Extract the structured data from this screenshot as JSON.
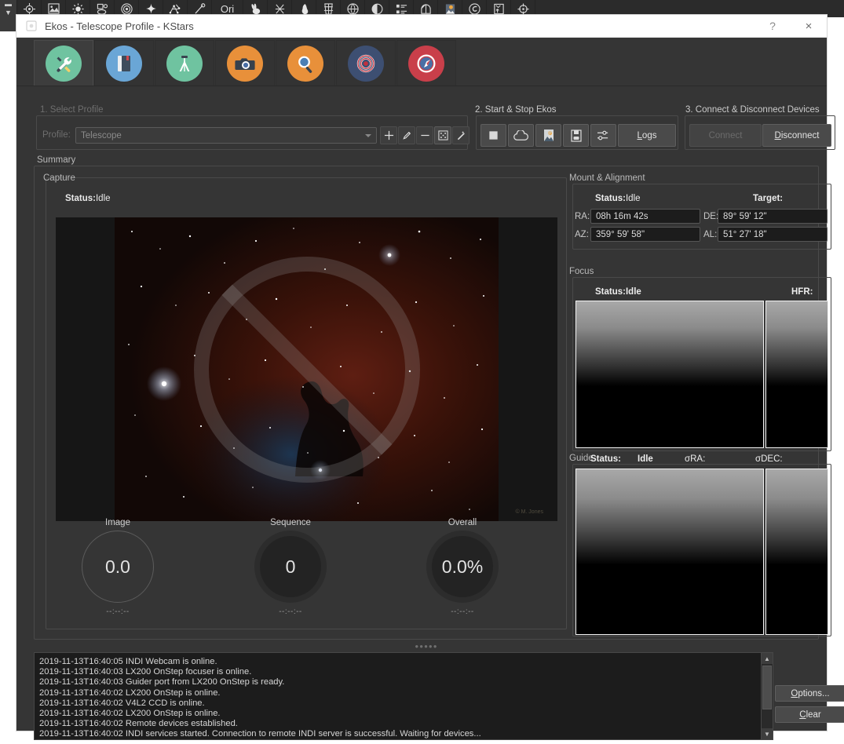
{
  "desktop": {
    "kstars_toolbar_icons": [
      "crosshair-target-icon",
      "image-icon",
      "sun-icon",
      "shapes-icon",
      "concentric-circles-icon",
      "star-icon",
      "constellation-lines-icon",
      "comet-icon",
      "orion-label-icon",
      "rabbit-icon",
      "constellation-art-icon",
      "flame-icon",
      "constellation-grid-icon",
      "celestial-grid-icon",
      "moon-phase-icon",
      "list-icon",
      "dome-icon",
      "fits-image-icon",
      "galaxy-icon",
      "export-image-icon",
      "find-object-icon"
    ],
    "orion_label": "Ori"
  },
  "window": {
    "title": "Ekos - Telescope Profile - KStars",
    "help_label": "?",
    "close_label": "×"
  },
  "tabs": [
    {
      "name": "tab-setup",
      "icon": "wrench-tools-icon",
      "color": "#6fc3a0",
      "active": true
    },
    {
      "name": "tab-scheduler",
      "icon": "book-scheduler-icon",
      "color": "#6aa6d6",
      "active": false
    },
    {
      "name": "tab-mount",
      "icon": "tripod-mount-icon",
      "color": "#6fc3a0",
      "active": false
    },
    {
      "name": "tab-capture",
      "icon": "camera-capture-icon",
      "color": "#e8903a",
      "active": false
    },
    {
      "name": "tab-focus",
      "icon": "magnifier-focus-icon",
      "color": "#e8903a",
      "active": false
    },
    {
      "name": "tab-align",
      "icon": "target-align-icon",
      "color": "#3d4f72",
      "active": false
    },
    {
      "name": "tab-guide",
      "icon": "compass-guide-icon",
      "color": "#c93f4a",
      "active": false
    }
  ],
  "sections": {
    "select_profile": "1. Select Profile",
    "start_stop": "2. Start & Stop Ekos",
    "connect_disconnect": "3. Connect & Disconnect Devices"
  },
  "profile": {
    "label": "Profile:",
    "value": "Telescope",
    "placeholder": "Telescope",
    "buttons": [
      {
        "name": "add-profile-button",
        "icon": "plus-icon"
      },
      {
        "name": "edit-profile-button",
        "icon": "pencil-icon"
      },
      {
        "name": "delete-profile-button",
        "icon": "minus-icon"
      },
      {
        "name": "scan-profile-button",
        "icon": "dice-icon"
      },
      {
        "name": "wizard-profile-button",
        "icon": "magic-wand-icon"
      }
    ]
  },
  "ekos_controls": {
    "buttons": [
      {
        "name": "stop-ekos-button",
        "icon": "stop-square-icon"
      },
      {
        "name": "cloud-button",
        "icon": "cloud-icon"
      },
      {
        "name": "ekos-live-button",
        "icon": "ekos-live-icon"
      },
      {
        "name": "indi-control-button",
        "icon": "indi-panel-icon"
      },
      {
        "name": "options-sliders-button",
        "icon": "sliders-icon"
      }
    ],
    "logs_label": "Logs",
    "logs_accel": "L"
  },
  "devices": {
    "connect_label": "Connect",
    "connect_enabled": false,
    "disconnect_label": "Disconnect",
    "disconnect_enabled": true
  },
  "summary": {
    "label": "Summary",
    "capture": {
      "label": "Capture",
      "status_label": "Status:",
      "status_value": "Idle",
      "preview_watermark": "© M. Jones",
      "gauges": [
        {
          "name": "image-gauge",
          "title": "Image",
          "value": "0.0",
          "time": "--:--:--",
          "style": "outline"
        },
        {
          "name": "sequence-gauge",
          "title": "Sequence",
          "value": "0",
          "time": "--:--:--",
          "style": "filled"
        },
        {
          "name": "overall-gauge",
          "title": "Overall",
          "value": "0.0%",
          "time": "--:--:--",
          "style": "filled"
        }
      ]
    },
    "mount": {
      "label": "Mount & Alignment",
      "status_label": "Status:",
      "status_value": "Idle",
      "target_label": "Target:",
      "ra_label": "RA:",
      "ra_value": "08h 16m 42s",
      "de_label": "DE:",
      "de_value": "89° 59' 12\"",
      "az_label": "AZ:",
      "az_value": "359° 59' 58\"",
      "al_label": "AL:",
      "al_value": "51° 27' 18\""
    },
    "focus": {
      "label": "Focus",
      "status_label": "Status:",
      "status_value": "Idle",
      "hfr_label": "HFR:"
    },
    "guide": {
      "label": "Guide",
      "status_label": "Status:",
      "status_value": "Idle",
      "sigma_ra_label": "σRA:",
      "sigma_dec_label": "σDEC:"
    }
  },
  "log": {
    "lines": [
      "2019-11-13T16:40:05 INDI Webcam is online.",
      "2019-11-13T16:40:03 LX200 OnStep focuser is online.",
      "2019-11-13T16:40:03 Guider port from LX200 OnStep is ready.",
      "2019-11-13T16:40:02 LX200 OnStep is online.",
      "2019-11-13T16:40:02 V4L2 CCD is online.",
      "2019-11-13T16:40:02 LX200 OnStep is online.",
      "2019-11-13T16:40:02 Remote devices established.",
      "2019-11-13T16:40:02 INDI services started. Connection to remote INDI server is successful. Waiting for devices..."
    ],
    "scroll_up": "▲",
    "scroll_down": "▼",
    "options_label": "Options...",
    "options_accel": "O",
    "clear_label": "Clear",
    "clear_accel": "C"
  },
  "colors": {
    "window_bg": "#353535",
    "panel_border": "#4a4a4a",
    "field_bg": "#1c1c1c",
    "text": "#d6d6d6",
    "disabled_text": "#6b6b6b"
  }
}
